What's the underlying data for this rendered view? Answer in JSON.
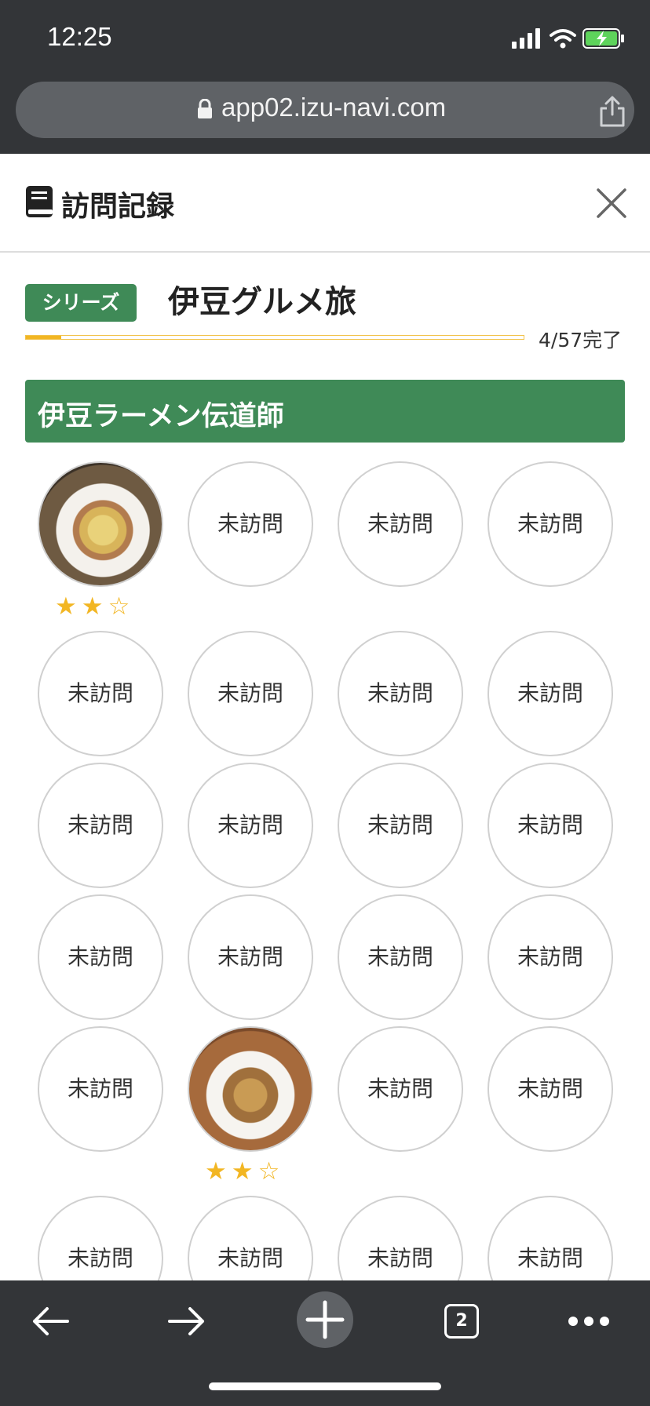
{
  "status": {
    "time": "12:25"
  },
  "browser": {
    "url": "app02.izu-navi.com",
    "tab_count": "2"
  },
  "header": {
    "title": "訪問記録"
  },
  "series": {
    "badge": "シリーズ",
    "title": "伊豆グルメ旅",
    "progress_text": "4/57完了",
    "progress_fraction": 0.0702
  },
  "section": {
    "title": "伊豆ラーメン伝道師"
  },
  "unvisited_label": "未訪問",
  "grid": {
    "columns": 4,
    "items": [
      {
        "visited": true,
        "photo": "ramen-lemon",
        "stars": 2,
        "max_stars": 3
      },
      {
        "visited": false
      },
      {
        "visited": false
      },
      {
        "visited": false
      },
      {
        "visited": false
      },
      {
        "visited": false
      },
      {
        "visited": false
      },
      {
        "visited": false
      },
      {
        "visited": false
      },
      {
        "visited": false
      },
      {
        "visited": false
      },
      {
        "visited": false
      },
      {
        "visited": false
      },
      {
        "visited": false
      },
      {
        "visited": false
      },
      {
        "visited": false
      },
      {
        "visited": false
      },
      {
        "visited": true,
        "photo": "ramen-bowl",
        "stars": 2,
        "max_stars": 3
      },
      {
        "visited": false
      },
      {
        "visited": false
      },
      {
        "visited": false
      },
      {
        "visited": false
      },
      {
        "visited": false
      },
      {
        "visited": false
      }
    ]
  },
  "colors": {
    "accent_green": "#3f8a57",
    "star_gold": "#f2b623",
    "chrome_dark": "#333538"
  }
}
